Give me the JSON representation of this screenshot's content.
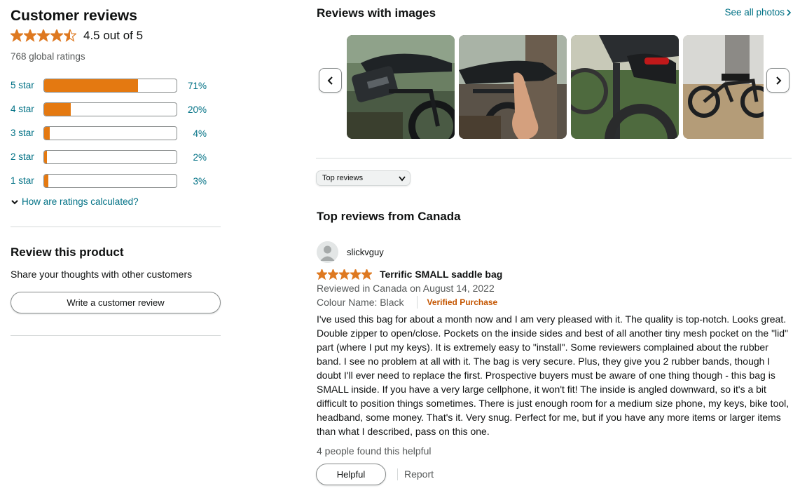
{
  "summary": {
    "heading": "Customer reviews",
    "rating": 4.5,
    "rating_text": "4.5 out of 5",
    "global_ratings": "768 global ratings",
    "star_color": "#de7921",
    "bar_color": "#e47911",
    "histogram": [
      {
        "label": "5 star",
        "percent": 71,
        "percent_text": "71%"
      },
      {
        "label": "4 star",
        "percent": 20,
        "percent_text": "20%"
      },
      {
        "label": "3 star",
        "percent": 4,
        "percent_text": "4%"
      },
      {
        "label": "2 star",
        "percent": 2,
        "percent_text": "2%"
      },
      {
        "label": "1 star",
        "percent": 3,
        "percent_text": "3%"
      }
    ],
    "how_calculated": "How are ratings calculated?"
  },
  "review_product": {
    "heading": "Review this product",
    "subtext": "Share your thoughts with other customers",
    "button_label": "Write a customer review"
  },
  "images_section": {
    "heading": "Reviews with images",
    "see_all": "See all photos",
    "prev_icon": "chevron-left-icon",
    "next_icon": "chevron-right-icon"
  },
  "sort": {
    "selected": "Top reviews"
  },
  "top_reviews": {
    "heading": "Top reviews from Canada"
  },
  "review": {
    "author": "slickvguy",
    "rating": 5,
    "title": "Terrific SMALL saddle bag",
    "reviewed_in": "Reviewed in Canada on August 14, 2022",
    "colour": "Colour Name: Black",
    "verified": "Verified Purchase",
    "body": "I've used this bag for about a month now and I am very pleased with it. The quality is top-notch. Looks great. Double zipper to open/close. Pockets on the inside sides and best of all another tiny mesh pocket on the \"lid\" part (where I put my keys). It is extremely easy to \"install\". Some reviewers complained about the rubber band. I see no problem at all with it. The bag is very secure. Plus, they give you 2 rubber bands, though I doubt I'll ever need to replace the first. Prospective buyers must be aware of one thing though - this bag is SMALL inside. If you have a very large cellphone, it won't fit! The inside is angled downward, so it's a bit difficult to position things sometimes. There is just enough room for a medium size phone, my keys, bike tool, headband, some money. That's it. Very snug. Perfect for me, but if you have any more items or larger items than what I described, pass on this one.",
    "helpful_count": "4 people found this helpful",
    "helpful_button": "Helpful",
    "report": "Report"
  }
}
